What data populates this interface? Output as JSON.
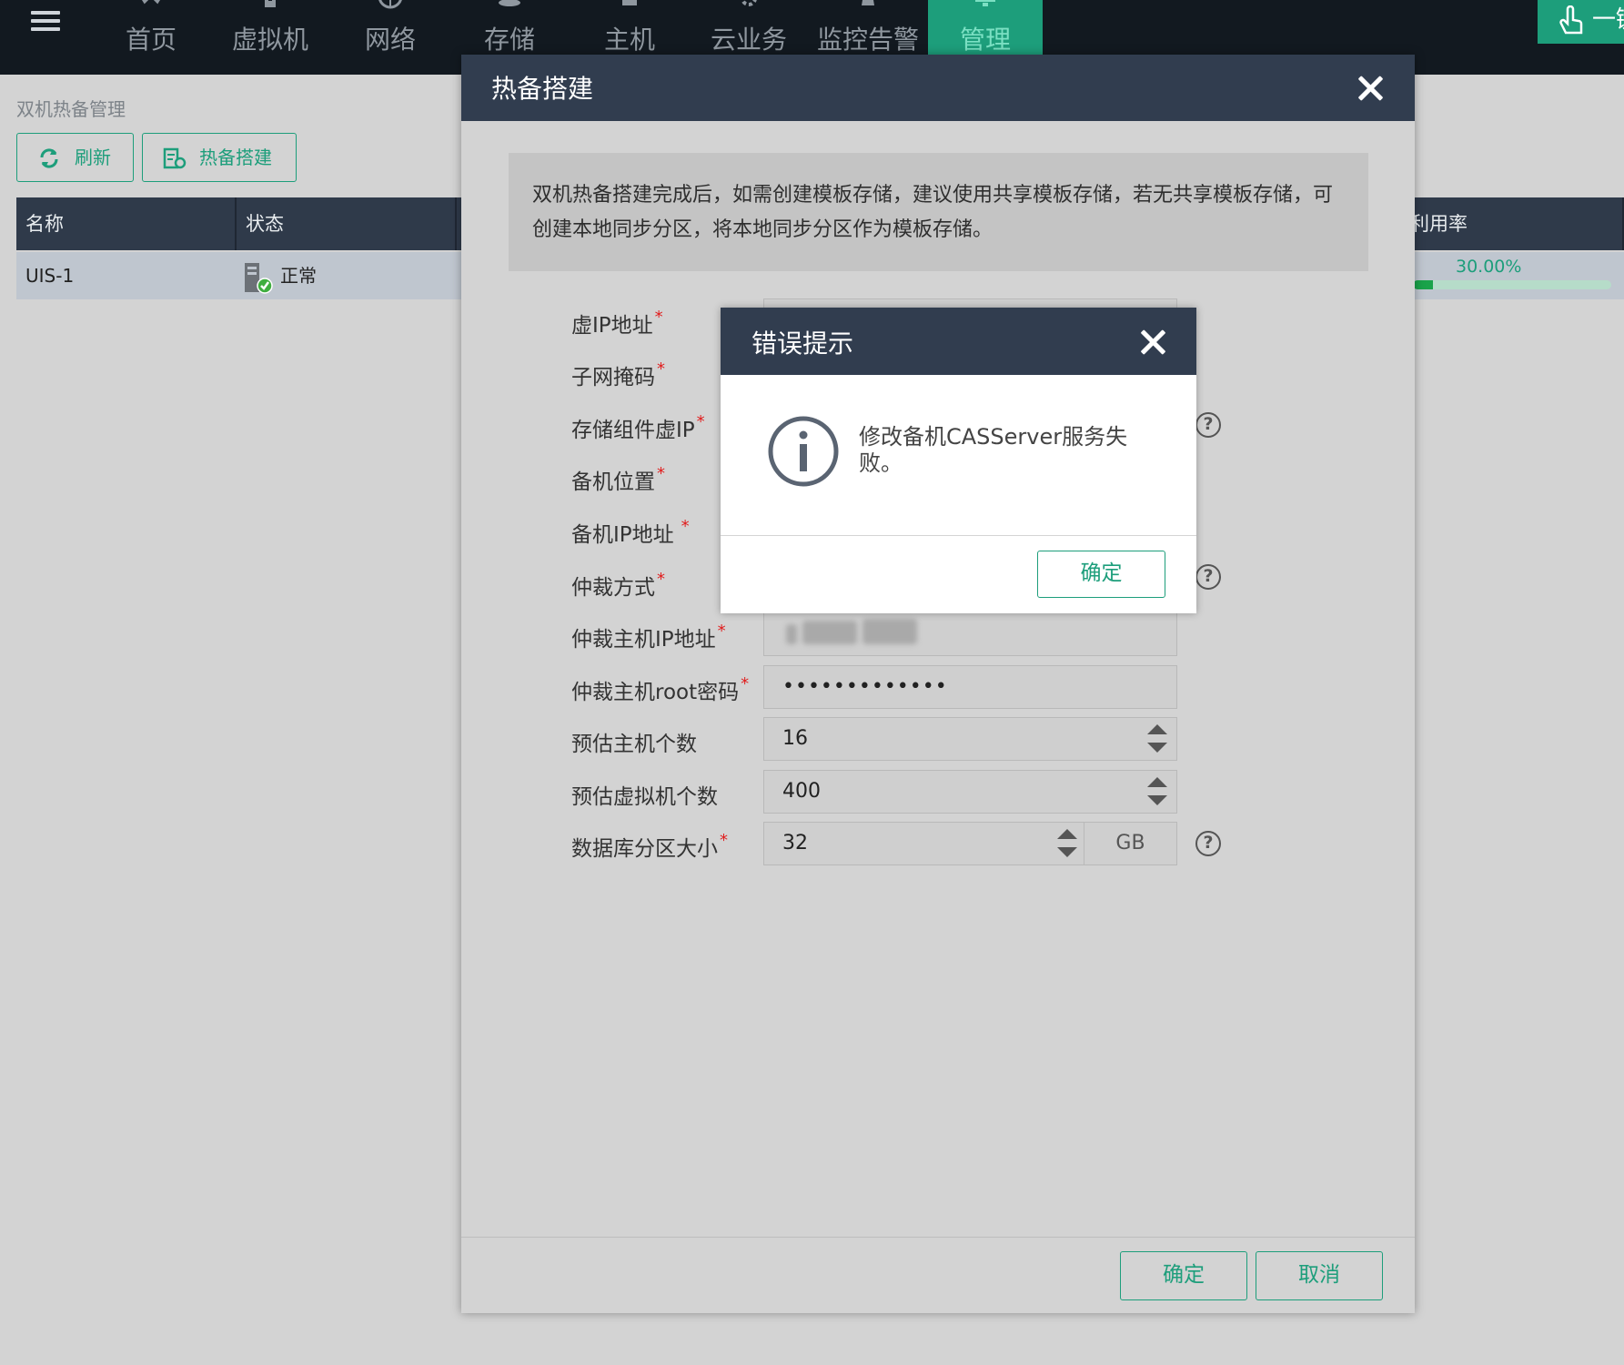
{
  "topnav": {
    "items": [
      "首页",
      "虚拟机",
      "网络",
      "存储",
      "主机",
      "云业务",
      "监控告警",
      "管理"
    ],
    "active": "管理",
    "onekey_label": "一键"
  },
  "page": {
    "breadcrumb": "双机热备管理",
    "toolbar": {
      "refresh_label": "刷新",
      "build_label": "热备搭建"
    },
    "table": {
      "headers": {
        "name": "名称",
        "status": "状态",
        "usage": "利用率"
      },
      "rows": [
        {
          "name": "UIS-1",
          "status": "正常",
          "usage_text": "30.00%",
          "usage_fraction": 0.1
        }
      ]
    }
  },
  "dialog": {
    "title": "热备搭建",
    "notice": "双机热备搭建完成后，如需创建模板存储，建议使用共享模板存储，若无共享模板存储，可创建本地同步分区，将本地同步分区作为模板存储。",
    "fields": {
      "vip": "虚IP地址",
      "mask": "子网掩码",
      "storage_vip": "存储组件虚IP",
      "backup_location": "备机位置",
      "backup_ip": "备机IP地址",
      "arbitration_mode": "仲裁方式",
      "arbiter_ip": "仲裁主机IP地址",
      "arbiter_pwd": "仲裁主机root密码",
      "est_hosts": "预估主机个数",
      "est_vms": "预估虚拟机个数",
      "db_size": "数据库分区大小"
    },
    "values": {
      "arbiter_pwd": "•••••••••••••",
      "est_hosts": "16",
      "est_vms": "400",
      "db_size": "32",
      "db_unit": "GB"
    },
    "required_mark": "*",
    "help_mark": "?",
    "ok_label": "确定",
    "cancel_label": "取消"
  },
  "alert": {
    "title": "错误提示",
    "message": "修改备机CASServer服务失败。",
    "ok_label": "确定"
  },
  "colors": {
    "accent": "#1d9e7b",
    "header_dark": "#313d4f",
    "topbar": "#121920",
    "required": "#e11d1d"
  }
}
